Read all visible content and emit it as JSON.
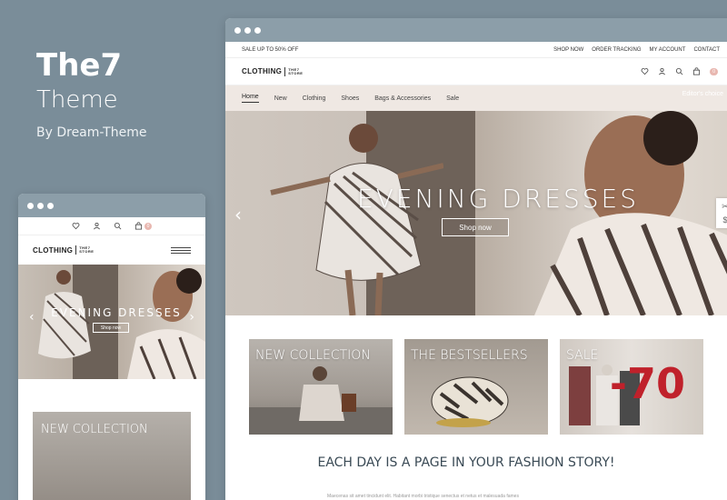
{
  "brand": {
    "title": "The7",
    "subtitle": "Theme",
    "byline": "By Dream-Theme"
  },
  "desktop": {
    "topbar": {
      "promo": "SALE UP TO 50% OFF",
      "links": [
        "SHOP NOW",
        "ORDER TRACKING",
        "MY ACCOUNT",
        "CONTACT"
      ]
    },
    "logo": {
      "main": "CLOTHING",
      "small_top": "THE7",
      "small_bottom": "STORE"
    },
    "cart_count": "0",
    "nav": {
      "items": [
        "Home",
        "New",
        "Clothing",
        "Shoes",
        "Bags & Accessories",
        "Sale"
      ],
      "active": "Home",
      "editor_label": "Editor's choice"
    },
    "hero": {
      "title": "EVENING DRESSES",
      "button": "Shop now"
    },
    "cards": [
      "NEW COLLECTION",
      "THE BESTSELLERS",
      "SALE"
    ],
    "sale_number": "-70",
    "tagline": "EACH DAY IS A PAGE IN YOUR FASHION STORY!",
    "lorem": "Maecenas sit amet tincidunt elit. Habitant morbi tristique senectus et netus et malesuada fames"
  },
  "mobile": {
    "logo": {
      "main": "CLOTHING",
      "small_top": "THE7",
      "small_bottom": "STORE"
    },
    "cart_count": "0",
    "hero": {
      "title": "EVENING DRESSES",
      "button": "Shop now"
    },
    "card": "NEW COLLECTION"
  },
  "colors": {
    "background": "#7a8d99",
    "nav_bg": "#efe8e3",
    "sale_red": "#c0212b",
    "accent_pink": "#e8b7b0"
  }
}
